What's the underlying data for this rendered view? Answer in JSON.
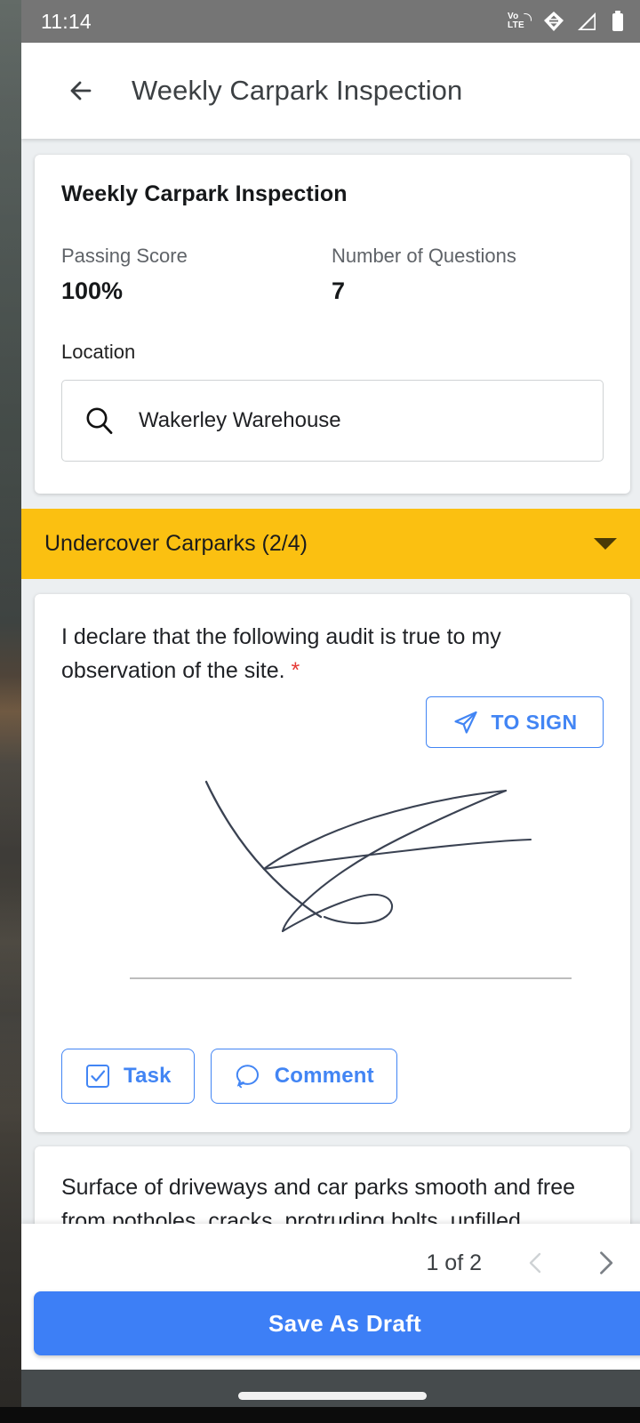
{
  "status_bar": {
    "time": "11:14",
    "icons": [
      "volte-icon",
      "wifi-icon",
      "signal-icon",
      "battery-icon"
    ],
    "volte_top": "Vo",
    "volte_bottom": "LTE",
    "background_color": "#757575"
  },
  "app_bar": {
    "back_icon": "arrow-left-icon",
    "title": "Weekly Carpark Inspection"
  },
  "summary": {
    "title": "Weekly Carpark Inspection",
    "stats": [
      {
        "label": "Passing Score",
        "value": "100%"
      },
      {
        "label": "Number of Questions",
        "value": "7"
      }
    ],
    "location_label": "Location",
    "location_value": "Wakerley Warehouse",
    "location_search_icon": "search-icon"
  },
  "section": {
    "title": "Undercover Carparks (2/4)",
    "background_color": "#fbc011",
    "chevron_icon": "chevron-down-icon"
  },
  "signature_question": {
    "text": "I declare that the following audit is true to my observation of the site.",
    "required_marker": "*",
    "to_sign_label": "TO SIGN",
    "to_sign_icon": "send-icon",
    "signature_present": true,
    "accent_color": "#4285f4",
    "actions": [
      {
        "label": "Task",
        "icon": "checkbox-checked-icon"
      },
      {
        "label": "Comment",
        "icon": "comment-bubble-icon"
      }
    ]
  },
  "next_question": {
    "text": "Surface of driveways and car parks smooth and free from potholes, cracks, protruding bolts, unfilled expansion joints etc.",
    "required_marker": "*"
  },
  "bottom_bar": {
    "page_indicator": "1 of 2",
    "prev_icon": "chevron-left-icon",
    "next_icon": "chevron-right-icon",
    "prev_enabled": false,
    "next_enabled": true,
    "save_label": "Save As Draft",
    "save_color": "#3d7ff6"
  },
  "nav_bar": {
    "home_indicator": "home-indicator-pill"
  }
}
